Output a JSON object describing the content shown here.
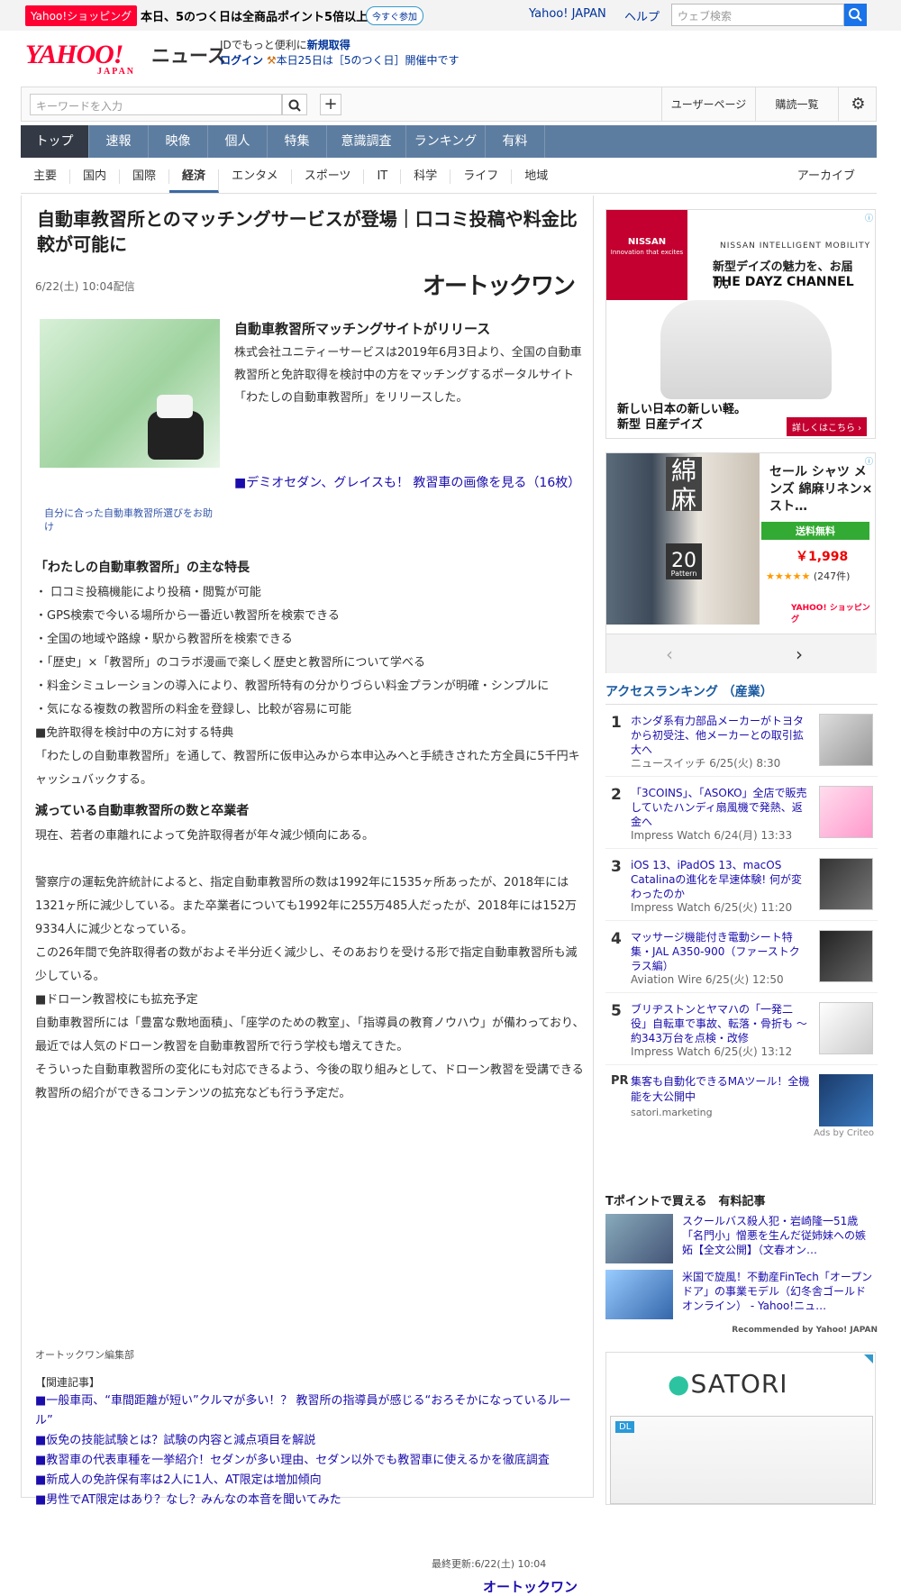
{
  "promo": {
    "badge": "Yahoo!ショッピング",
    "text": "本日、5のつく日は全商品ポイント5倍以上！",
    "join": "今すぐ参加",
    "yahoo_japan": "Yahoo! JAPAN",
    "help": "ヘルプ",
    "search_placeholder": "ウェブ検索"
  },
  "header": {
    "logo": "YAHOO!",
    "logo_sub": "JAPAN",
    "section": "ニュース",
    "id_text": "IDでもっと便利に",
    "new_id": "新規取得",
    "login": "ログイン",
    "notice": "本日25日は［5のつく日］開催中です"
  },
  "toolbar": {
    "keyword_placeholder": "キーワードを入力",
    "user_page": "ユーザーページ",
    "subscriptions": "購読一覧"
  },
  "global_nav": [
    "トップ",
    "速報",
    "映像",
    "個人",
    "特集",
    "意識調査",
    "ランキング",
    "有料"
  ],
  "sub_nav": [
    "主要",
    "国内",
    "国際",
    "経済",
    "エンタメ",
    "スポーツ",
    "IT",
    "科学",
    "ライフ",
    "地域"
  ],
  "archive": "アーカイブ",
  "article": {
    "title": "自動車教習所とのマッチングサービスが登場｜口コミ投稿や料金比較が可能に",
    "date": "6/22(土) 10:04配信",
    "source": "オートックワン",
    "photo_caption": "自分に合った自動車教習所選びをお助け",
    "lede_heading": "自動車教習所マッチングサイトがリリース",
    "lede_text": "株式会社ユニティーサービスは2019年6月3日より、全国の自動車教習所と免許取得を検討中の方をマッチングするポータルサイト「わたしの自動車教習所」をリリースした。",
    "image_link": "■デミオセダン、グレイスも！ 教習車の画像を見る（16枚）",
    "h_features": "「わたしの自動車教習所」の主な特長",
    "features": [
      "・ 口コミ投稿機能により投稿・閲覧が可能",
      "・GPS検索で今いる場所から一番近い教習所を検索できる",
      "・全国の地域や路線・駅から教習所を検索できる",
      "・「歴史」×「教習所」のコラボ漫画で楽しく歴史と教習所について学べる",
      "・料金シミュレーションの導入により、教習所特有の分かりづらい料金プランが明確・シンプルに",
      "・気になる複数の教習所の料金を登録し、比較が容易に可能",
      "■免許取得を検討中の方に対する特典",
      "「わたしの自動車教習所」を通して、教習所に仮申込みから本申込みへと手続きされた方全員に5千円キャッシュバックする。"
    ],
    "h_decline": "減っている自動車教習所の数と卒業者",
    "decline_p1": "現在、若者の車離れによって免許取得者が年々減少傾向にある。",
    "decline_p2": "警察庁の運転免許統計によると、指定自動車教習所の数は1992年に1535ヶ所あったが、2018年には1321ヶ所に減少している。また卒業者についても1992年に255万485人だったが、2018年には152万9334人に減少となっている。",
    "decline_p3": "この26年間で免許取得者の数がおよそ半分近く減少し、そのあおりを受ける形で指定自動車教習所も減少している。",
    "decline_p4": "■ドローン教習校にも拡充予定",
    "decline_p5": "自動車教習所には「豊富な敷地面積」、「座学のための教室」、「指導員の教育ノウハウ」が備わっており、最近では人気のドローン教習を自動車教習所で行う学校も増えてきた。",
    "decline_p6": "そういった自動車教習所の変化にも対応できるよう、今後の取り組みとして、ドローン教習を受講できる教習所の紹介ができるコンテンツの拡充なども行う予定だ。",
    "editor": "オートックワン編集部",
    "related_heading": "【関連記事】",
    "related": [
      "■一般車両、“車間距離が短い”クルマが多い！？ 教習所の指導員が感じる“おろそかになっているルール”",
      "■仮免の技能試験とは？試験の内容と減点項目を解説",
      "■教習車の代表車種を一挙紹介！セダンが多い理由、セダン以外でも教習車に使えるかを徹底調査",
      "■新成人の免許保有率は2人に1人、AT限定は増加傾向",
      "■男性でAT限定はあり？なし？みんなの本音を聞いてみた"
    ],
    "last_updated": "最終更新:6/22(土) 10:04",
    "source_link": "オートックワン"
  },
  "ad_nissan": {
    "brand": "NISSAN",
    "brand_sub": "Innovation that excites",
    "tagline": "NISSAN INTELLIGENT MOBILITY",
    "headline": "新型デイズの魅力を、お届け。",
    "channel": "THE DAYZ CHANNEL",
    "copy1": "新しい日本の新しい軽。",
    "copy2": "新型 日産デイズ",
    "cta": "詳しくはこちら ›"
  },
  "ad_shop": {
    "linen": "綿麻",
    "pattern_count": "20",
    "pattern": "Pattern",
    "name": "セール シャツ メンズ 綿麻リネン×スト…",
    "shipping": "送料無料",
    "price": "￥1,998",
    "stars": "★★★★★",
    "reviews": "(247件)",
    "shop": "YAHOO! ショッピング"
  },
  "ranking": {
    "heading": "アクセスランキング （産業）",
    "items": [
      {
        "rank": "1",
        "title": "ホンダ系有力部品メーカーがトヨタから初受注、他メーカーとの取引拡大へ",
        "meta": "ニュースイッチ 6/25(火) 8:30"
      },
      {
        "rank": "2",
        "title": "「3COINS」、「ASOKO」全店で販売していたハンディ扇風機で発熱、返金へ",
        "meta": "Impress Watch 6/24(月) 13:33"
      },
      {
        "rank": "3",
        "title": "iOS 13、iPadOS 13、macOS Catalinaの進化を早速体験! 何が変わったのか",
        "meta": "Impress Watch 6/25(火) 11:20"
      },
      {
        "rank": "4",
        "title": "マッサージ機能付き電動シート特集・JAL A350-900（ファーストクラス編）",
        "meta": "Aviation Wire 6/25(火) 12:50"
      },
      {
        "rank": "5",
        "title": "ブリヂストンとヤマハの「一発二役」自転車で事故、転落・骨折も ～約343万台を点検・改修",
        "meta": "Impress Watch 6/25(火) 13:12"
      }
    ],
    "pr_label": "PR",
    "pr_title": "集客も自動化できるMAツール！全機能を大公開中",
    "pr_source": "satori.marketing",
    "criteo": "Ads by Criteo"
  },
  "tpoint": {
    "heading": "Tポイントで買える　有料記事",
    "items": [
      "スクールバス殺人犯・岩崎隆一51歳　「名門小」憎悪を生んだ従姉妹への嫉妬【全文公開】（文春オン…",
      "米国で旋風！不動産FinTech「オープンドア」の事業モデル（幻冬舎ゴールドオンライン） - Yahoo!ニュ…"
    ],
    "recommended": "Recommended by Yahoo! JAPAN"
  },
  "ad_satori": {
    "logo": "SATORI",
    "dl": "DL"
  },
  "colors": {
    "nav_bg": "#5d7da0",
    "nav_active": "#333a45",
    "link": "#1a0dab",
    "accent": "#f03"
  }
}
